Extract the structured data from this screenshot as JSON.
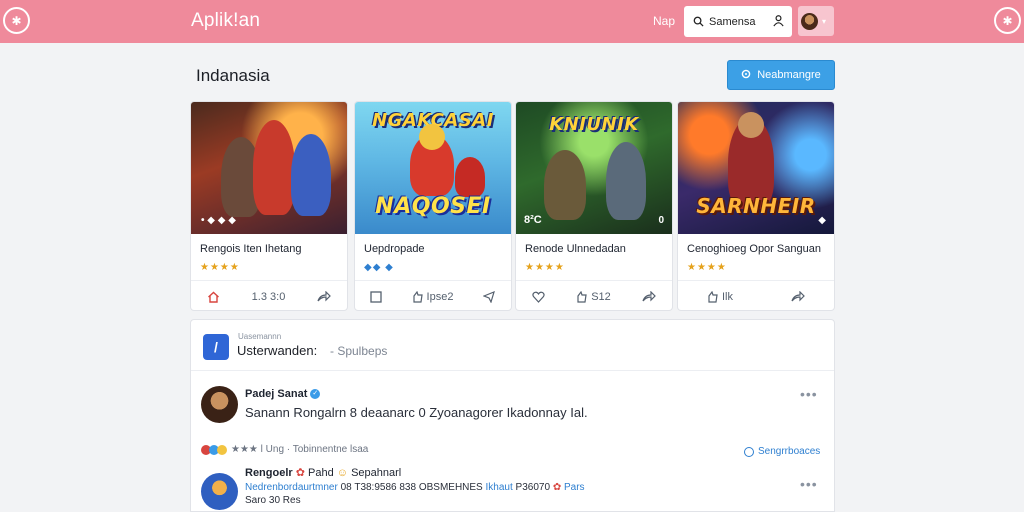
{
  "header": {
    "logo_text": "✱",
    "app_title": "Aplik!an",
    "nav_link": "Nap",
    "search_value": "Samensa",
    "corner_icon": "✱",
    "colors": {
      "bar": "#ef8a9b"
    }
  },
  "section": {
    "title": "Indanasia",
    "primary_button": "Neabmangre"
  },
  "games": [
    {
      "thumb_title": "",
      "thumb_badge": "• ◆ ◆ ◆",
      "thumb_corner": "",
      "name": "Rengois Iten Ihetang",
      "rating": "★★★★",
      "actions": [
        "",
        "1.3  3:0",
        ""
      ]
    },
    {
      "thumb_title": "NGAKCASAI",
      "thumb_subtitle": "NAQOSEI",
      "thumb_badge": "",
      "thumb_corner": "",
      "name": "Uepdropade",
      "rating": "◆◆ ◆",
      "actions": [
        "",
        "Ipse2",
        ""
      ]
    },
    {
      "thumb_title": "KNIUNIK",
      "thumb_badge": "8²C",
      "thumb_corner": "0",
      "name": "Renode Ulnnedadan",
      "rating": "★★★★",
      "actions": [
        "",
        "S12",
        ""
      ]
    },
    {
      "thumb_title": "",
      "thumb_subtitle": "SARNHEIR",
      "thumb_badge": "",
      "thumb_corner": "◆",
      "name": "Cenoghioeg Opor Sanguan",
      "rating": "★★★★",
      "actions": [
        "",
        "Ilk",
        ""
      ]
    }
  ],
  "feed": {
    "head_small": "Uasemannn",
    "head_title": "Usterwanden:",
    "head_sub": "- Spulbeps",
    "posts": [
      {
        "author": "Padej Sanat",
        "text": "Sanann Rongalrn 8 deaanarc 0 Zyoanagorer Ikadonnay Ial.",
        "reacts_text": "★★★ l Ung  ·  Tobinnentne lsaa",
        "follow_label": "Sengrrboaces"
      },
      {
        "author": "Rengoelr",
        "author_extra": "Pahd",
        "author_tail": "Sepahnarl",
        "line1_blue": "Nedrenbordaurtmner",
        "line1_text": "08  T38:9586 838 OBSMEHNES",
        "line1_blue2": "Ikhaut",
        "line1_text2": "P36070",
        "line1_tail": "Pars",
        "line2": "Saro 30 Res"
      }
    ]
  }
}
